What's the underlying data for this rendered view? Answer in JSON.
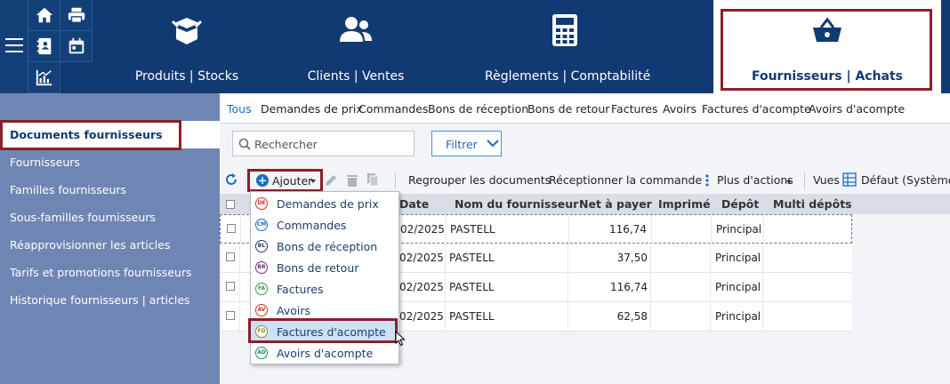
{
  "topbar": {
    "modules": [
      {
        "label": "Produits | Stocks",
        "icon": "box-icon"
      },
      {
        "label": "Clients | Ventes",
        "icon": "users-icon"
      },
      {
        "label": "Règlements | Comptabilité",
        "icon": "calculator-icon"
      },
      {
        "label": "Fournisseurs | Achats",
        "icon": "basket-icon"
      }
    ],
    "quick_icons": [
      "home-icon",
      "printer-icon",
      "address-book-icon",
      "calendar-icon",
      "chart-icon"
    ]
  },
  "sidebar": {
    "items": [
      {
        "label": "Documents fournisseurs"
      },
      {
        "label": "Fournisseurs"
      },
      {
        "label": "Familles fournisseurs"
      },
      {
        "label": "Sous-familles fournisseurs"
      },
      {
        "label": "Réapprovisionner les articles"
      },
      {
        "label": "Tarifs et promotions fournisseurs"
      },
      {
        "label": "Historique fournisseurs | articles"
      }
    ]
  },
  "tabs": [
    {
      "label": "Tous"
    },
    {
      "label": "Demandes de prix"
    },
    {
      "label": "Commandes"
    },
    {
      "label": "Bons de réception"
    },
    {
      "label": "Bons de retour"
    },
    {
      "label": "Factures"
    },
    {
      "label": "Avoirs"
    },
    {
      "label": "Factures d'acompte"
    },
    {
      "label": "Avoirs d'acompte"
    }
  ],
  "search": {
    "placeholder": "Rechercher"
  },
  "filter": {
    "label": "Filtrer"
  },
  "toolbar": {
    "add_label": "Ajouter",
    "group_label": "Regrouper les documents",
    "receive_label": "Réceptionner la commande",
    "more_label": "Plus d'actions",
    "views_label": "Vues",
    "view_value": "Défaut (Système)"
  },
  "grid": {
    "columns": [
      "Date",
      "Nom du fournisseur",
      "Net à payer",
      "Imprimé",
      "Dépôt",
      "Multi dépôts"
    ],
    "rows": [
      {
        "date": "02/2025",
        "supplier": "PASTELL",
        "net": "116,74",
        "printed": "",
        "depot": "Principal",
        "multi": ""
      },
      {
        "date": "02/2025",
        "supplier": "PASTELL",
        "net": "37,50",
        "printed": "",
        "depot": "Principal",
        "multi": ""
      },
      {
        "date": "02/2025",
        "supplier": "PASTELL",
        "net": "116,74",
        "printed": "",
        "depot": "Principal",
        "multi": ""
      },
      {
        "date": "02/2025",
        "supplier": "PASTELL",
        "net": "62,58",
        "printed": "",
        "depot": "Principal",
        "multi": ""
      }
    ]
  },
  "add_menu": {
    "items": [
      {
        "code": "DE",
        "label": "Demandes de prix",
        "color": "#c0392b"
      },
      {
        "code": "CM",
        "label": "Commandes",
        "color": "#1a6cc8"
      },
      {
        "code": "BL",
        "label": "Bons de réception",
        "color": "#1f3d6b"
      },
      {
        "code": "BR",
        "label": "Bons de retour",
        "color": "#7b2d7b"
      },
      {
        "code": "FA",
        "label": "Factures",
        "color": "#2e9e4a"
      },
      {
        "code": "AV",
        "label": "Avoirs",
        "color": "#c0392b"
      },
      {
        "code": "FD",
        "label": "Factures d'acompte",
        "color": "#8a8a3a"
      },
      {
        "code": "AD",
        "label": "Avoirs d'acompte",
        "color": "#1a8a6a"
      }
    ],
    "selected_index": 6
  },
  "colors": {
    "header_bg": "#123a72",
    "sidebar_bg": "#6f86b5",
    "accent": "#1a6cc8",
    "highlight_border": "#8b1f2a"
  }
}
